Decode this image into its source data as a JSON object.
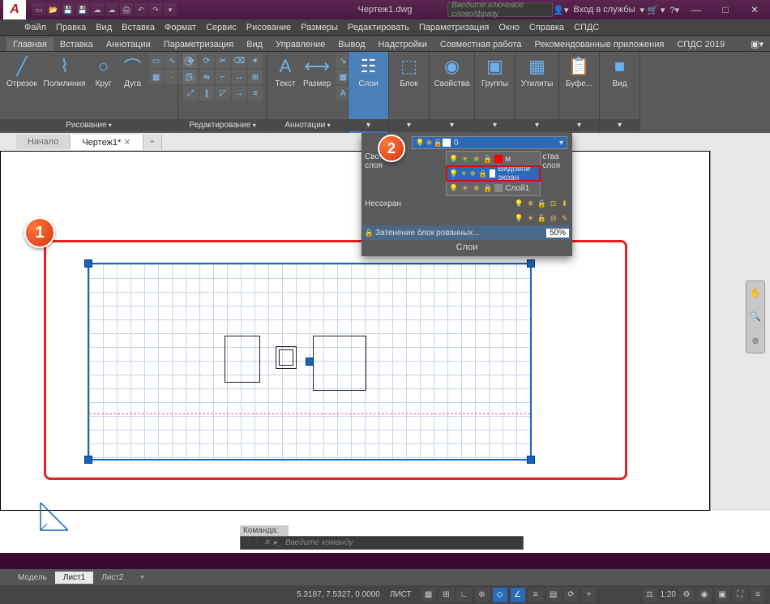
{
  "title": "Чертеж1.dwg",
  "search_placeholder": "Введите ключевое слово/фразу",
  "login_label": "Вход в службы",
  "menubar": [
    "Файл",
    "Правка",
    "Вид",
    "Вставка",
    "Формат",
    "Сервис",
    "Рисование",
    "Размеры",
    "Редактировать",
    "Параметризация",
    "Окно",
    "Справка",
    "СПДС"
  ],
  "tabs": [
    "Главная",
    "Вставка",
    "Аннотации",
    "Параметризация",
    "Вид",
    "Управление",
    "Вывод",
    "Надстройки",
    "Совместная работа",
    "Рекомендованные приложения",
    "СПДС 2019"
  ],
  "active_tab": "Главная",
  "ribbon": {
    "draw": {
      "title": "Рисование",
      "btns": [
        "Отрезок",
        "Полилиния",
        "Круг",
        "Дуга"
      ]
    },
    "edit": {
      "title": "Редактирование"
    },
    "annot": {
      "title": "Аннотации",
      "btns": [
        "Текст",
        "Размер"
      ]
    },
    "layers": {
      "title": "Слои"
    },
    "block": {
      "title": "Блок"
    },
    "props": {
      "title": "Свойства"
    },
    "groups": {
      "title": "Группы"
    },
    "utils": {
      "title": "Утилиты"
    },
    "clip": {
      "title": "Буфе..."
    },
    "view": {
      "title": "Вид"
    }
  },
  "doc_tabs": {
    "start": "Начало",
    "active": "Чертеж1*",
    "plus": "+"
  },
  "layer_panel": {
    "selected": "0",
    "left1": "Сво...",
    "left2": "слоя",
    "left3": "Несохран",
    "right_label": "ства слоя",
    "items": [
      {
        "name": "м",
        "hl": false,
        "sw": "r"
      },
      {
        "name": "Видовой экран",
        "hl": true,
        "sw": "w"
      },
      {
        "name": "Слой1",
        "hl": false,
        "sw": "g"
      }
    ],
    "shade": "Затенение блок",
    "shade2": "рованных...",
    "shade_pct": "50%",
    "footer": "Слои"
  },
  "callouts": {
    "one": "1",
    "two": "2"
  },
  "cmd": {
    "hist": "Команда:",
    "placeholder": "Введите команду"
  },
  "layout_tabs": [
    "Модель",
    "Лист1",
    "Лист2",
    "+"
  ],
  "active_layout": "Лист1",
  "status": {
    "coords": "5.3187, 7.5327, 0.0000",
    "space": "ЛИСТ",
    "scale": "1:20"
  }
}
